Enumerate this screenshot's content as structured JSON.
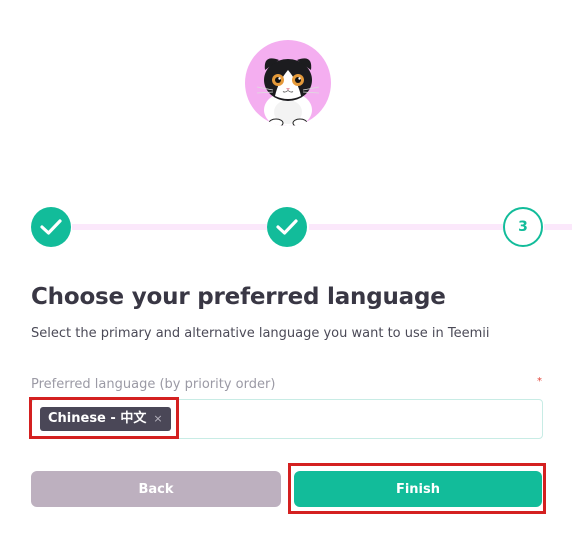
{
  "avatar": {
    "icon": "cat-avatar-icon",
    "background_color": "#f4aef0"
  },
  "stepper": {
    "steps": [
      {
        "state": "completed",
        "icon": "checkmark-icon"
      },
      {
        "state": "completed",
        "icon": "checkmark-icon"
      },
      {
        "state": "current",
        "label": "3"
      }
    ],
    "accent_color": "#12bc9a",
    "track_color": "#fbe8fb"
  },
  "content": {
    "title": "Choose your preferred language",
    "subtitle": "Select the primary and alternative language you want to use in Teemii"
  },
  "language_field": {
    "label": "Preferred language (by priority order)",
    "required_mark": "*",
    "selected_tags": [
      {
        "label": "Chinese - 中文",
        "remove_symbol": "×"
      }
    ]
  },
  "actions": {
    "back_label": "Back",
    "finish_label": "Finish"
  },
  "colors": {
    "primary": "#12bc9a",
    "back_button": "#bdb0bf",
    "tag_background": "#4a4757",
    "highlight": "#d42020"
  }
}
